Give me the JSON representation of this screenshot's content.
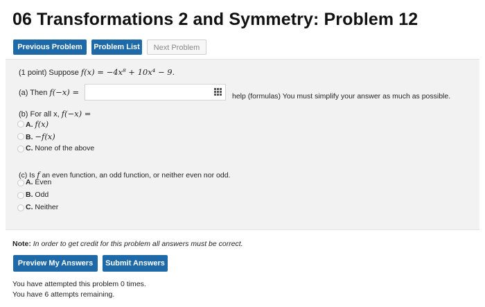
{
  "page": {
    "title": "06 Transformations 2 and Symmetry: Problem 12"
  },
  "nav": {
    "previous": "Previous Problem",
    "list": "Problem List",
    "next": "Next Problem"
  },
  "problem": {
    "points": "(1 point) Suppose",
    "function": "f(x) = −4x⁸ + 10x⁴ − 9.",
    "part_a": {
      "label": "(a) Then",
      "expr": "f(−x) =",
      "input_value": "",
      "help_link": "help (formulas)",
      "hint": "You must simplify your answer as much as possible."
    },
    "part_b": {
      "label": "(b) For all x,",
      "expr": "f(−x) =",
      "options": [
        {
          "letter": "A.",
          "text": "f(x)"
        },
        {
          "letter": "B.",
          "text": "−f(x)"
        },
        {
          "letter": "C.",
          "text": "None of the above"
        }
      ]
    },
    "part_c": {
      "label": "(c) Is",
      "func": "f",
      "rest": "an even function, an odd function, or neither even nor odd.",
      "options": [
        {
          "letter": "A.",
          "text": "Even"
        },
        {
          "letter": "B.",
          "text": "Odd"
        },
        {
          "letter": "C.",
          "text": "Neither"
        }
      ]
    }
  },
  "note": {
    "label": "Note:",
    "text": "In order to get credit for this problem all answers must be correct."
  },
  "actions": {
    "preview": "Preview My Answers",
    "submit": "Submit Answers"
  },
  "footer": {
    "attempted": "You have attempted this problem 0 times.",
    "remaining": "You have 6 attempts remaining."
  },
  "colors": {
    "primary_button": "#1e6aa8",
    "problem_bg": "#f2f2f2"
  }
}
